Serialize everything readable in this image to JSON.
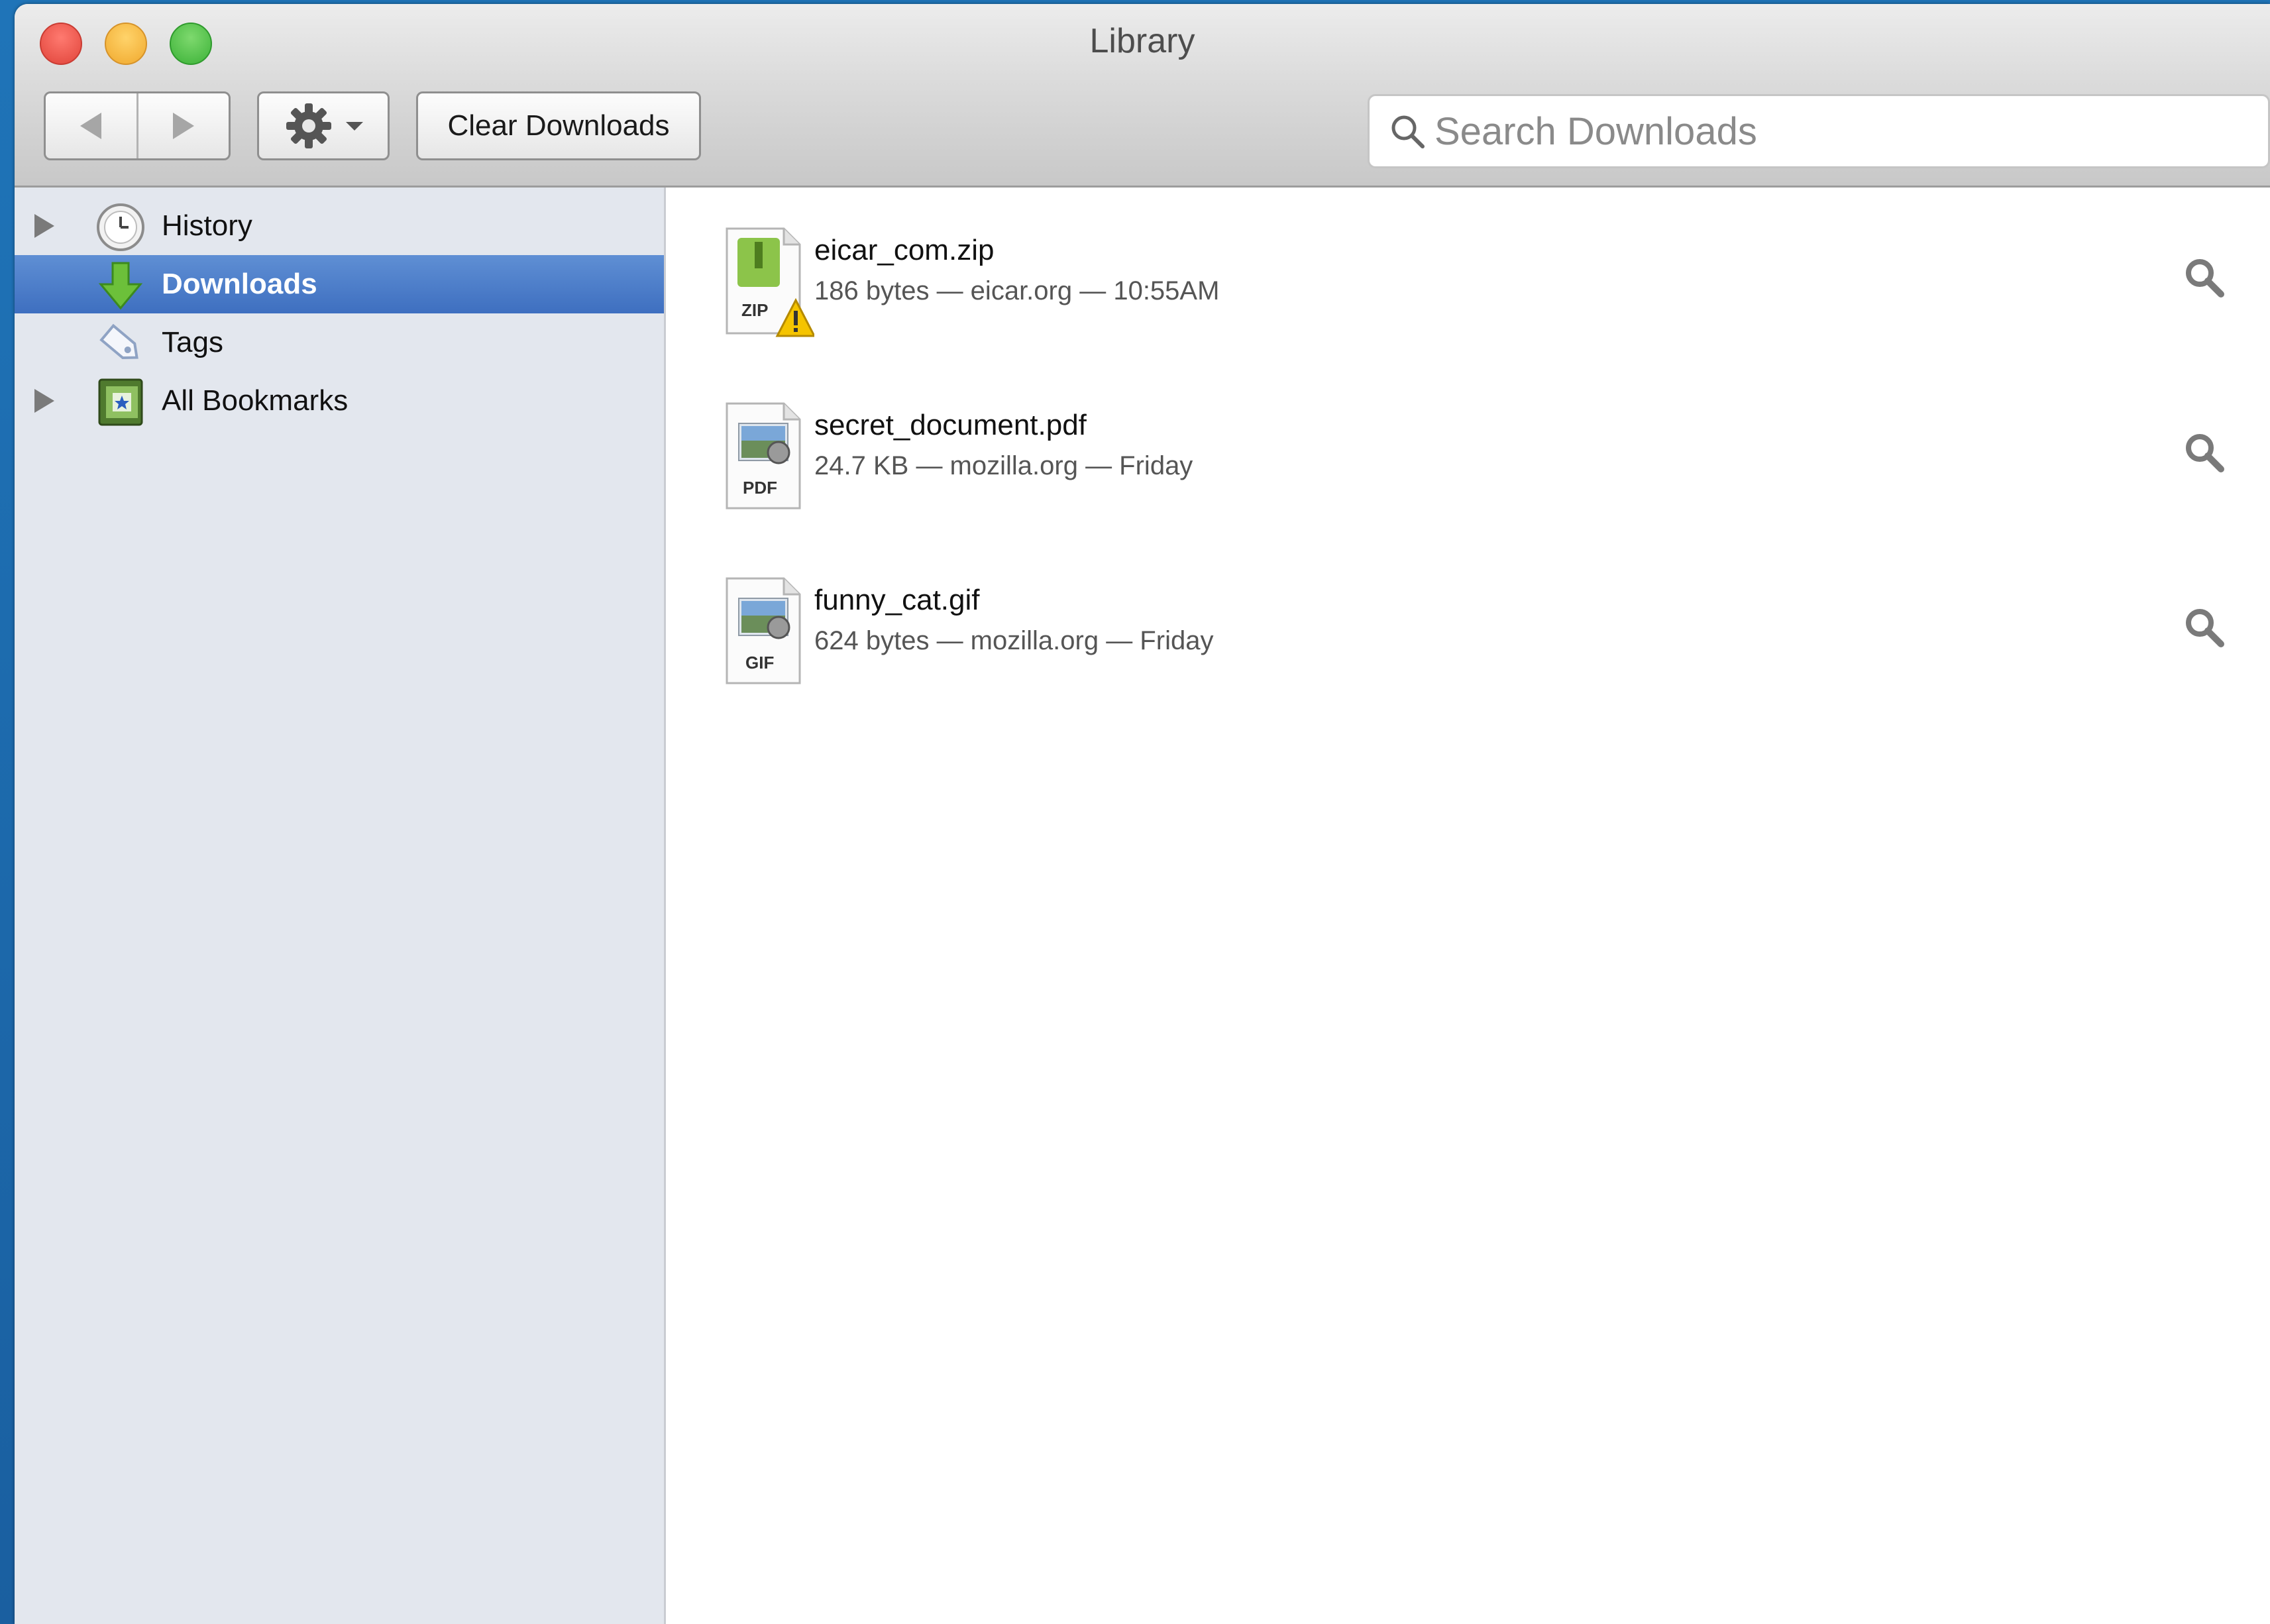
{
  "window": {
    "title": "Library"
  },
  "toolbar": {
    "back_icon": "back-arrow-icon",
    "forward_icon": "forward-arrow-icon",
    "organize_icon": "gear-icon",
    "clear_label": "Clear Downloads"
  },
  "search": {
    "placeholder": "Search Downloads",
    "value": ""
  },
  "sidebar": {
    "items": [
      {
        "label": "History",
        "icon": "clock-icon",
        "expandable": true,
        "selected": false
      },
      {
        "label": "Downloads",
        "icon": "download-arrow-icon",
        "expandable": false,
        "selected": true
      },
      {
        "label": "Tags",
        "icon": "tag-icon",
        "expandable": false,
        "selected": false
      },
      {
        "label": "All Bookmarks",
        "icon": "bookmarks-book-icon",
        "expandable": true,
        "selected": false
      }
    ]
  },
  "downloads": [
    {
      "name": "eicar_com.zip",
      "meta": "186 bytes — eicar.org — 10:55AM",
      "type_label": "ZIP",
      "warning": true
    },
    {
      "name": "secret_document.pdf",
      "meta": "24.7 KB — mozilla.org — Friday",
      "type_label": "PDF",
      "warning": false
    },
    {
      "name": "funny_cat.gif",
      "meta": "624 bytes — mozilla.org — Friday",
      "type_label": "GIF",
      "warning": false
    }
  ],
  "colors": {
    "selection": "#3e6fc0",
    "sidebar_bg": "#e3e7ee",
    "desktop": "#1f74b8"
  }
}
